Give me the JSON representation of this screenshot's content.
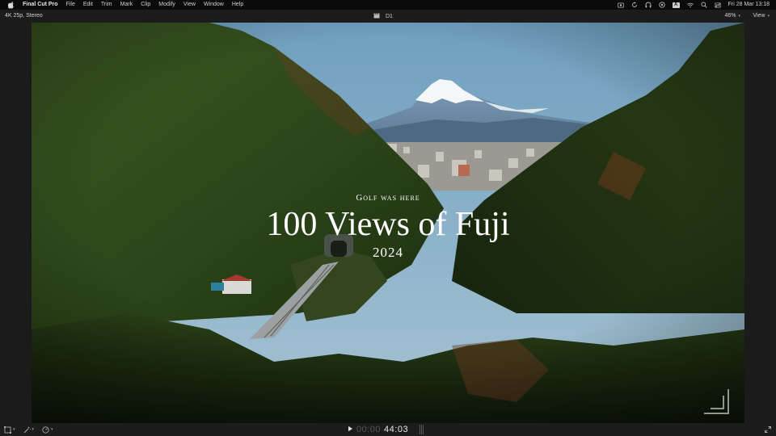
{
  "menubar": {
    "app_name": "Final Cut Pro",
    "menus": [
      "File",
      "Edit",
      "Trim",
      "Mark",
      "Clip",
      "Modify",
      "View",
      "Window",
      "Help"
    ],
    "clock": "Fri 28 Mar  13:18",
    "input_badge": "A"
  },
  "viewer_header": {
    "format": "4K 25p, Stereo",
    "project_name": "D1",
    "zoom": "46%",
    "view_label": "View"
  },
  "title_card": {
    "kicker": "Golf was here",
    "title": "100 Views of Fuji",
    "year": "2024"
  },
  "transport": {
    "timecode_dim": "00:00",
    "timecode": "44:03"
  },
  "colors": {
    "sky": "#7eaac4",
    "forest_dark": "#1a2a10",
    "accent_white": "#ffffff"
  }
}
